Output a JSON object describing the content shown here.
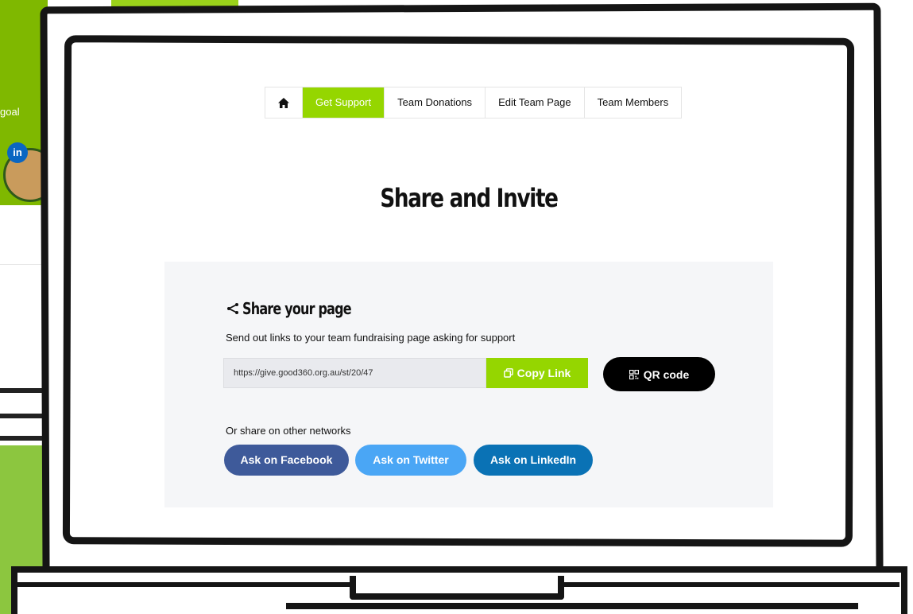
{
  "background": {
    "goal_text": "goal",
    "linkedin_badge": "in",
    "colors": {
      "green": "#7fb800",
      "linkedin": "#0a66c2"
    }
  },
  "nav": {
    "home_icon": "home-icon",
    "items": [
      "Get Support",
      "Team Donations",
      "Edit Team Page",
      "Team Members"
    ],
    "active": "Get Support"
  },
  "page": {
    "heading": "Share and Invite"
  },
  "share": {
    "title": "Share your page",
    "title_icon": "share-icon",
    "description": "Send out links to your team fundraising page asking for support",
    "link_value": "https://give.good360.org.au/st/20/47",
    "copy_label": "Copy Link",
    "copy_icon": "copy-icon",
    "qr_label": "QR code",
    "qr_icon": "qr-code-icon",
    "other_networks_label": "Or share on other networks",
    "networks": [
      {
        "label": "Ask on Facebook",
        "color": "#3e5a9a"
      },
      {
        "label": "Ask on Twitter",
        "color": "#4aa6f5"
      },
      {
        "label": "Ask on LinkedIn",
        "color": "#0a72b5"
      }
    ]
  },
  "colors": {
    "accent": "#95d600",
    "panel_bg": "#f5f6f8",
    "frame": "#151515"
  }
}
